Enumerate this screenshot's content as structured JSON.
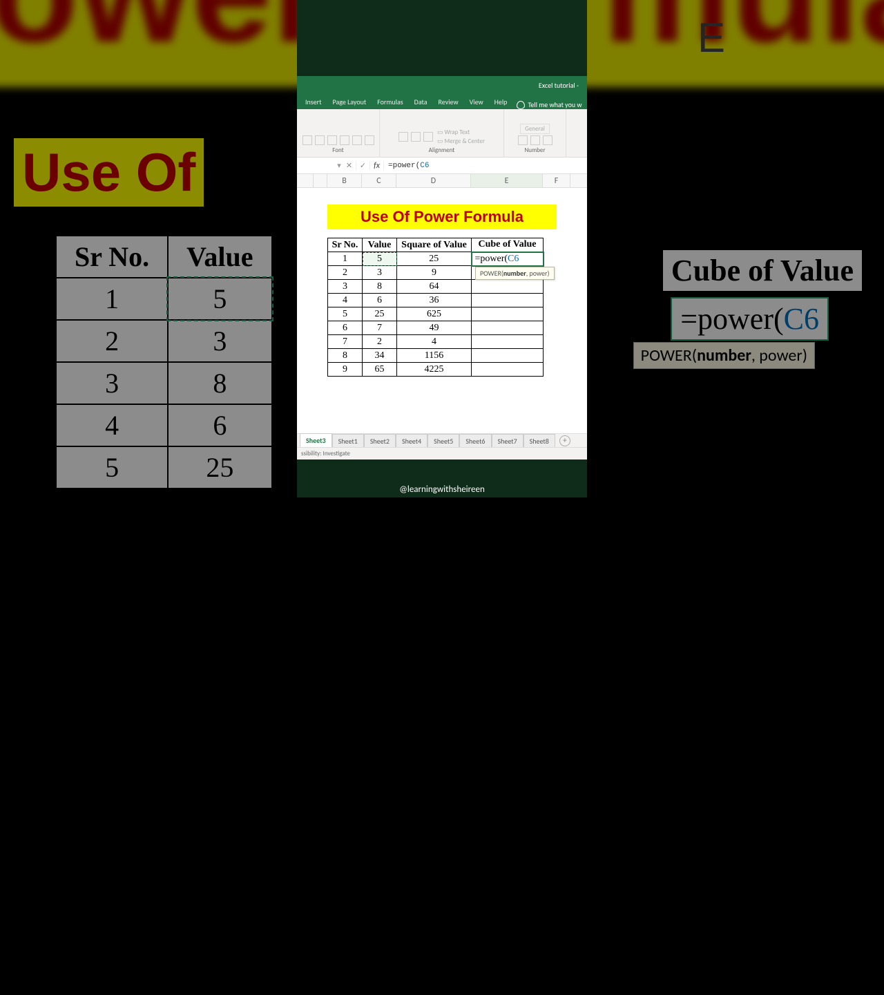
{
  "app_title": "Excel tutorial -",
  "ribbon_tabs": [
    "Insert",
    "Page Layout",
    "Formulas",
    "Data",
    "Review",
    "View",
    "Help"
  ],
  "tell_me": "Tell me what you w",
  "ribbon_groups": {
    "font": "Font",
    "alignment": "Alignment",
    "number": "Number",
    "wrap": "Wrap Text",
    "merge": "Merge & Center",
    "general": "General"
  },
  "formula_bar": {
    "name_box": "",
    "formula_prefix": "=power(",
    "formula_ref": "C6"
  },
  "columns": [
    "B",
    "C",
    "D",
    "E",
    "F"
  ],
  "banner": "Use Of Power Formula",
  "table": {
    "headers": [
      "Sr No.",
      "Value",
      "Square of Value",
      "Cube of Value"
    ],
    "rows": [
      {
        "sr": "1",
        "val": "5",
        "sq": "25",
        "cube_formula_prefix": "=power(",
        "cube_formula_ref": "C6"
      },
      {
        "sr": "2",
        "val": "3",
        "sq": "9",
        "cube": ""
      },
      {
        "sr": "3",
        "val": "8",
        "sq": "64",
        "cube": ""
      },
      {
        "sr": "4",
        "val": "6",
        "sq": "36",
        "cube": ""
      },
      {
        "sr": "5",
        "val": "25",
        "sq": "625",
        "cube": ""
      },
      {
        "sr": "6",
        "val": "7",
        "sq": "49",
        "cube": ""
      },
      {
        "sr": "7",
        "val": "2",
        "sq": "4",
        "cube": ""
      },
      {
        "sr": "8",
        "val": "34",
        "sq": "1156",
        "cube": ""
      },
      {
        "sr": "9",
        "val": "65",
        "sq": "4225",
        "cube": ""
      }
    ]
  },
  "tooltip": {
    "fn": "POWER(",
    "arg1": "number",
    "rest": ", power)"
  },
  "sheet_tabs": [
    "Sheet3",
    "Sheet1",
    "Sheet2",
    "Sheet4",
    "Sheet5",
    "Sheet6",
    "Sheet7",
    "Sheet8"
  ],
  "active_sheet": "Sheet3",
  "status": "ssibility: Investigate",
  "credit": "@learningwithsheireen",
  "bg_left_title": "Use Of",
  "bg_right_formula_prefix": "=power(",
  "bg_right_formula_ref": "C6"
}
